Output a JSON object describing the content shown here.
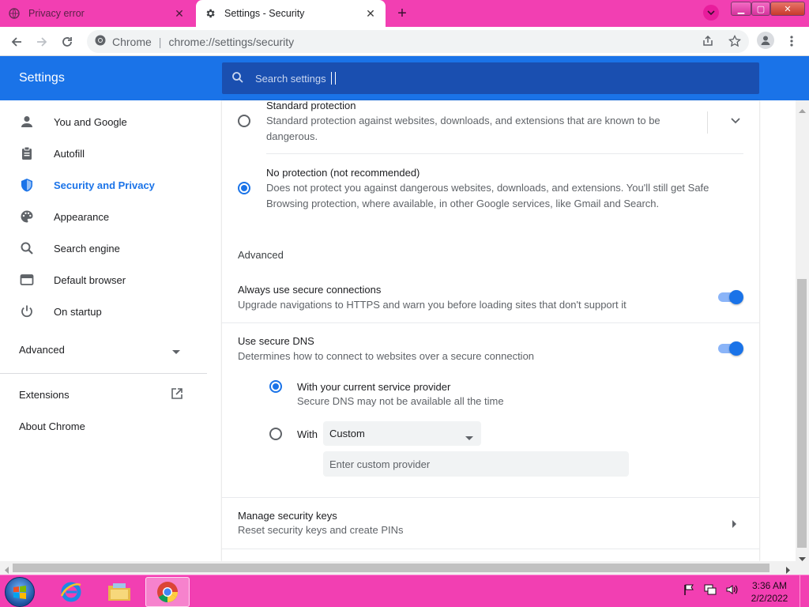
{
  "tabs": [
    {
      "title": "Privacy error",
      "active": false
    },
    {
      "title": "Settings - Security",
      "active": true
    }
  ],
  "omnibox": {
    "origin": "Chrome",
    "url": "chrome://settings/security"
  },
  "settings": {
    "title": "Settings",
    "search_placeholder": "Search settings"
  },
  "sidebar": {
    "items": [
      {
        "label": "You and Google",
        "icon": "person-icon"
      },
      {
        "label": "Autofill",
        "icon": "clipboard-icon"
      },
      {
        "label": "Security and Privacy",
        "icon": "shield-icon",
        "selected": true
      },
      {
        "label": "Appearance",
        "icon": "palette-icon"
      },
      {
        "label": "Search engine",
        "icon": "search-icon"
      },
      {
        "label": "Default browser",
        "icon": "browser-icon"
      },
      {
        "label": "On startup",
        "icon": "power-icon"
      }
    ],
    "advanced": "Advanced",
    "extensions": "Extensions",
    "about": "About Chrome"
  },
  "main": {
    "standard": {
      "title": "Standard protection",
      "desc_line1": "Standard protection against websites, downloads, and extensions that are known to be",
      "desc_line2": "dangerous.",
      "selected": false
    },
    "noprotection": {
      "title": "No protection (not recommended)",
      "desc_line1": "Does not protect you against dangerous websites, downloads, and extensions. You'll still get Safe",
      "desc_line2": "Browsing protection, where available, in other Google services, like Gmail and Search.",
      "selected": true
    },
    "advanced_heading": "Advanced",
    "https": {
      "title": "Always use secure connections",
      "desc": "Upgrade navigations to HTTPS and warn you before loading sites that don't support it",
      "enabled": true
    },
    "dns": {
      "title": "Use secure DNS",
      "desc": "Determines how to connect to websites over a secure connection",
      "enabled": true,
      "option_current_title": "With your current service provider",
      "option_current_desc": "Secure DNS may not be available all the time",
      "option_with_label": "With",
      "provider_selected": "Custom",
      "custom_placeholder": "Enter custom provider"
    },
    "keys": {
      "title": "Manage security keys",
      "desc": "Reset security keys and create PINs"
    }
  },
  "taskbar": {
    "time": "3:36 AM",
    "date": "2/2/2022"
  },
  "colors": {
    "accent": "#1a73e8",
    "frame": "#f23fb2",
    "header": "#1a73e8"
  }
}
